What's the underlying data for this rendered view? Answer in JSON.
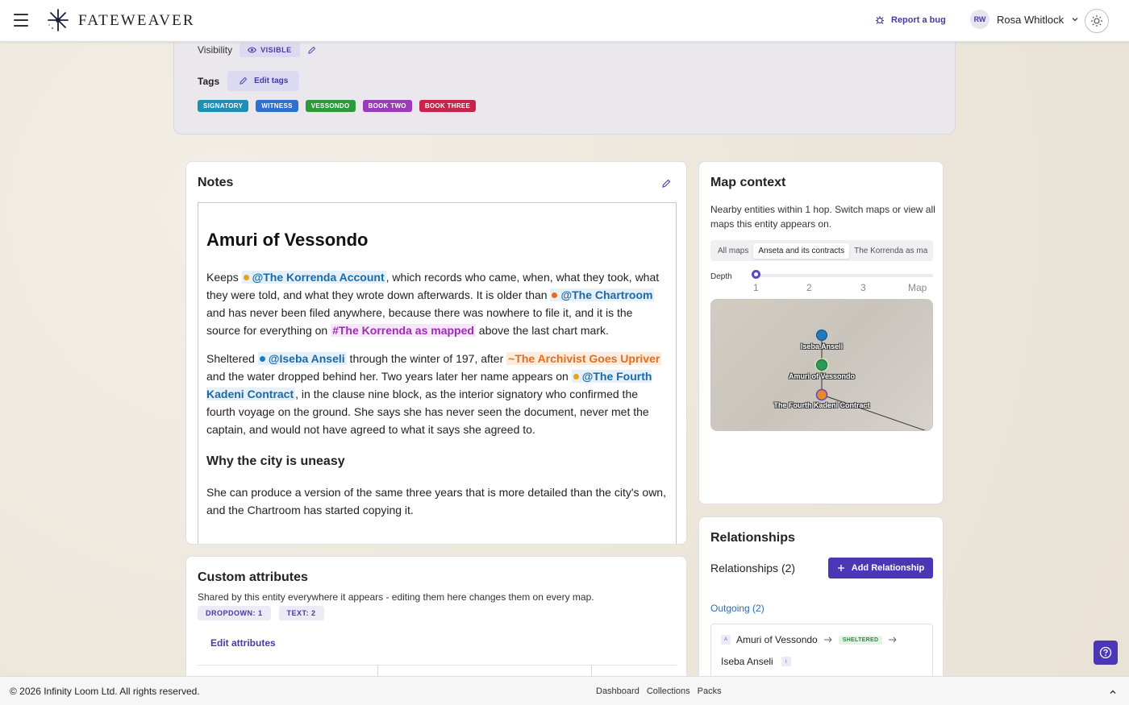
{
  "header": {
    "brand": "FATEWEAVER",
    "report_bug": "Report a bug",
    "user_initials": "RW",
    "user_name": "Rosa Whitlock"
  },
  "entity": {
    "visibility_label": "Visibility",
    "visibility_value": "VISIBLE",
    "tags_label": "Tags",
    "edit_tags": "Edit tags",
    "tags": [
      {
        "label": "SIGNATORY",
        "color": "#1d8fb5"
      },
      {
        "label": "WITNESS",
        "color": "#2f6fd0"
      },
      {
        "label": "VESSONDO",
        "color": "#2e9a3e"
      },
      {
        "label": "BOOK TWO",
        "color": "#9a3cb8"
      },
      {
        "label": "BOOK THREE",
        "color": "#c8234a"
      }
    ]
  },
  "notes": {
    "title": "Notes",
    "heading": "Amuri of Vessondo",
    "p1": {
      "t1": "Keeps ",
      "m1": "@The Korrenda Account",
      "t2": ", which records who came, when, what they took, what they were told, and what they wrote down afterwards. It is older than ",
      "m2": "@The Chartroom",
      "t3": " and has never been filed anywhere, because there was nowhere to file it, and it is the source for everything on ",
      "h1": "#The Korrenda as mapped",
      "t4": " above the last chart mark."
    },
    "p2": {
      "t1": "Sheltered ",
      "m1": "@Iseba Anseli",
      "t2": " through the winter of 197, after ",
      "e1": "~The Archivist Goes Upriver",
      "t3": " and the water dropped behind her. Two years later her name appears on ",
      "m2": "@The Fourth Kadeni Contract",
      "t4": ", in the clause nine block, as the interior signatory who confirmed the fourth voyage on the ground. She says she has never seen the document, never met the captain, and would not have agreed to what it says she agreed to."
    },
    "subheading": "Why the city is uneasy",
    "p3": "She can produce a version of the same three years that is more detailed than the city's own, and the Chartroom has started copying it."
  },
  "map": {
    "title": "Map context",
    "description": "Nearby entities within 1 hop. Switch maps or view all maps this entity appears on.",
    "tabs": [
      "All maps",
      "Anseta and its contracts",
      "The Korrenda as ma"
    ],
    "active_tab": 1,
    "depth_label": "Depth",
    "depth_ticks": [
      "1",
      "2",
      "3",
      "Map"
    ],
    "depth_value": 1,
    "nodes": [
      {
        "label": "Iseba Anseli",
        "color": "#1f7ac0"
      },
      {
        "label": "Amuri of Vessondo",
        "color": "#2e9a5a"
      },
      {
        "label": "The Fourth Kadeni Contract",
        "color": "#e88a2a"
      }
    ]
  },
  "relationships": {
    "title": "Relationships",
    "count_label": "Relationships (2)",
    "add_button": "Add Relationship",
    "outgoing": "Outgoing (2)",
    "row": {
      "from": "Amuri of Vessondo",
      "badge": "A",
      "relation": "SHELTERED",
      "to": "Iseba Anseli",
      "info": "i"
    }
  },
  "attributes": {
    "title": "Custom attributes",
    "description": "Shared by this entity everywhere it appears - editing them here changes them on every map.",
    "chips": [
      "DROPDOWN: 1",
      "TEXT: 2"
    ],
    "edit_link": "Edit attributes"
  },
  "footer": {
    "copyright": "© 2026 Infinity Loom Ltd. All rights reserved.",
    "links": [
      "Dashboard",
      "Collections",
      "Packs"
    ]
  }
}
